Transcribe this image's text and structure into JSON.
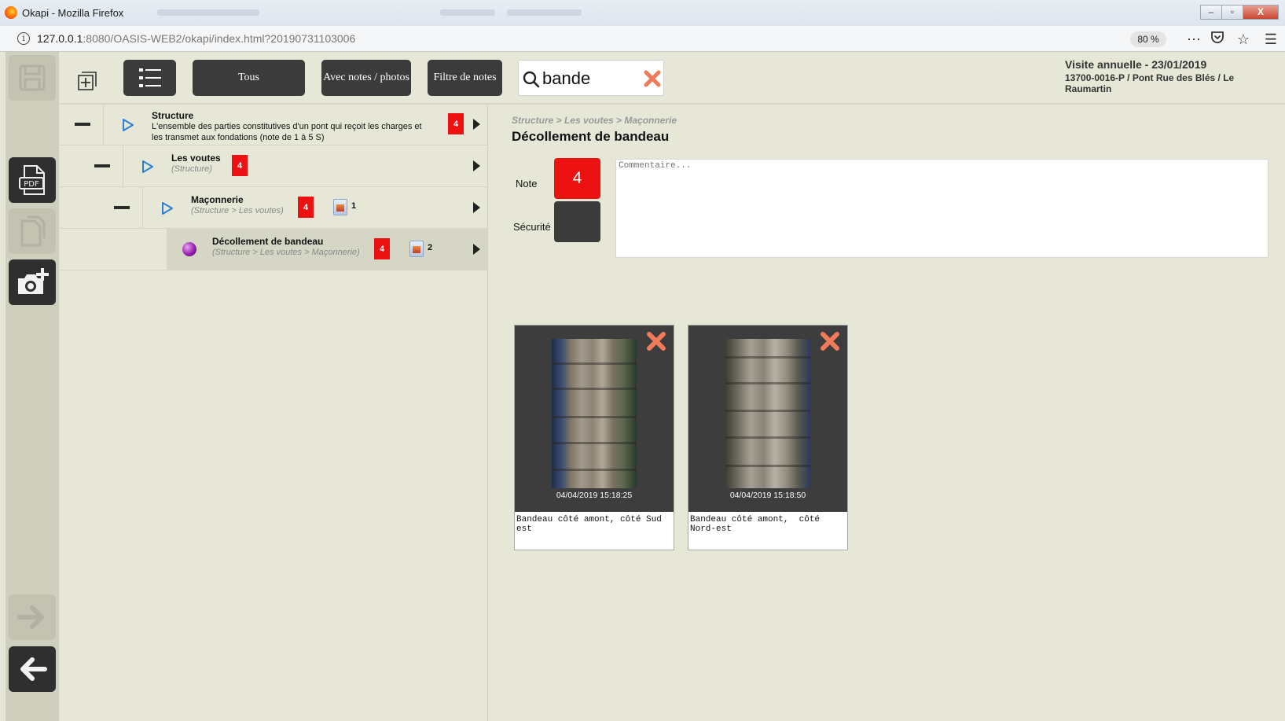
{
  "browser": {
    "window_title": "Okapi - Mozilla Firefox",
    "url_host": "127.0.0.1",
    "url_rest": ":8080/OASIS-WEB2/okapi/index.html?20190731103006",
    "zoom": "80 %",
    "window_buttons": [
      "‒",
      "▫",
      "X"
    ]
  },
  "sidebar": {
    "buttons": [
      {
        "name": "save",
        "enabled": false
      },
      {
        "name": "pdf",
        "enabled": true
      },
      {
        "name": "copy",
        "enabled": false
      },
      {
        "name": "add-photo",
        "enabled": true
      },
      {
        "name": "forward",
        "enabled": false
      },
      {
        "name": "back",
        "enabled": true
      }
    ]
  },
  "toolbar": {
    "all_label": "Tous",
    "with_notes_label": "Avec notes / photos",
    "filter_label": "Filtre de notes",
    "search_value": "bande"
  },
  "visit": {
    "title": "Visite annuelle - 23/01/2019",
    "subtitle": "13700-0016-P / Pont Rue des Blés / Le Raumartin"
  },
  "tree": {
    "rows": [
      {
        "title": "Structure",
        "description": "L'ensemble des parties constitutives d'un pont qui reçoit les charges et les transmet aux fondations (note de 1 à 5 S)",
        "badge": "4"
      },
      {
        "title": "Les voutes",
        "path": "(Structure)",
        "badge": "4"
      },
      {
        "title": "Maçonnerie",
        "path": "(Structure > Les voutes)",
        "badge": "4",
        "photos": "1"
      },
      {
        "title": "Décollement de bandeau",
        "path": "(Structure > Les voutes > Maçonnerie)",
        "badge": "4",
        "photos": "2"
      }
    ]
  },
  "detail": {
    "breadcrumb": "Structure > Les voutes > Maçonnerie",
    "title": "Décollement de bandeau",
    "note_label": "Note",
    "note_value": "4",
    "security_label": "Sécurité",
    "comment_placeholder": "Commentaire...",
    "photos": [
      {
        "timestamp": "04/04/2019 15:18:25",
        "caption": "Bandeau côté amont, côté Sud est"
      },
      {
        "timestamp": "04/04/2019 15:18:50",
        "caption": "Bandeau côté amont,  côté Nord-est"
      }
    ]
  },
  "colors": {
    "accent_red": "#ee1111",
    "dark_button": "#3b3b3b",
    "app_background": "#e7e7d8",
    "sidebar_background": "#cfcfbe",
    "delete_orange": "#f07a5a"
  }
}
